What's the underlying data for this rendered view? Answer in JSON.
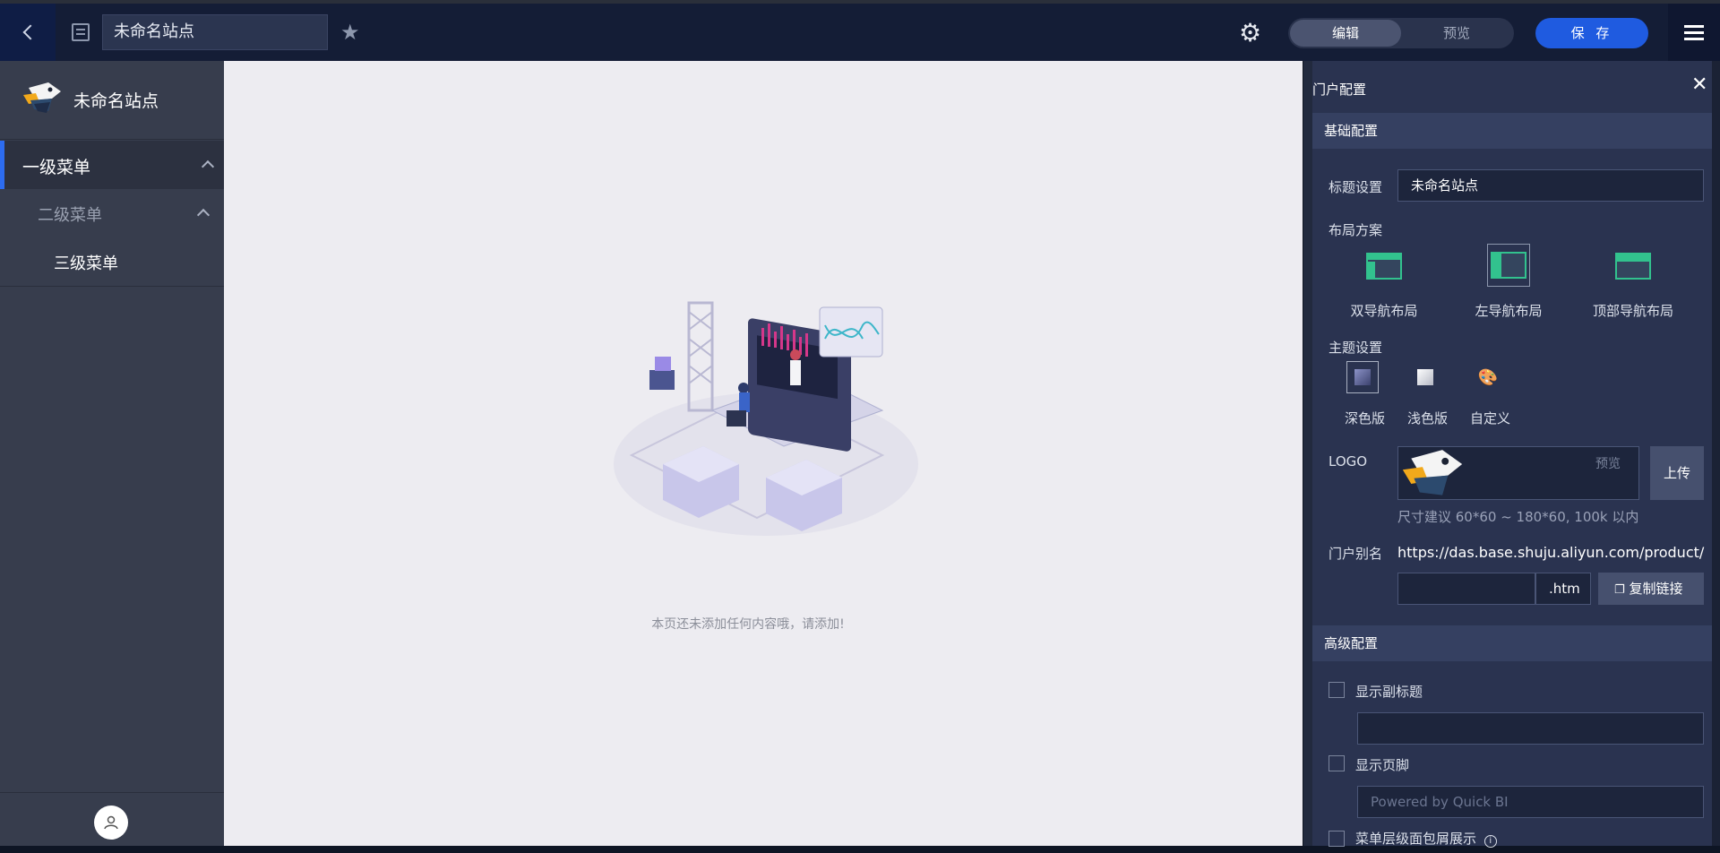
{
  "topbar": {
    "back_icon": "chevron-left-icon",
    "doc_icon": "document-icon",
    "title_value": "未命名站点",
    "star_icon": "star-icon",
    "gear_icon": "gear-icon",
    "edit_label": "编辑",
    "preview_label": "预览",
    "save_label": "保 存",
    "menu_icon": "hamburger-menu-icon"
  },
  "sidebar": {
    "site_name": "未命名站点",
    "menu_l1": "一级菜单",
    "menu_l2": "二级菜单",
    "menu_l3": "三级菜单"
  },
  "canvas": {
    "empty_message": "本页还未添加任何内容哦，请添加!"
  },
  "panel": {
    "title": "门户配置",
    "basic_section": "基础配置",
    "title_label": "标题设置",
    "title_value": "未命名站点",
    "layout_label": "布局方案",
    "layouts": [
      "双导航布局",
      "左导航布局",
      "顶部导航布局"
    ],
    "theme_label": "主题设置",
    "themes": [
      "深色版",
      "浅色版",
      "自定义"
    ],
    "logo_label": "LOGO",
    "logo_preview": "预览",
    "upload_label": "上传",
    "logo_hint": "尺寸建议 60*60 ~ 180*60, 100k 以内",
    "alias_label": "门户别名",
    "alias_url": "https://das.base.shuju.aliyun.com/product/",
    "alias_suffix": ".htm",
    "copy_link": "复制链接",
    "advanced_section": "高级配置",
    "show_subtitle": "显示副标题",
    "show_footer": "显示页脚",
    "footer_placeholder": "Powered by Quick BI",
    "breadcrumb_option": "菜单层级面包屑展示"
  },
  "colors": {
    "accent": "#2d6cf0",
    "save": "#1f5be0",
    "layout_green": "#32c28e"
  }
}
